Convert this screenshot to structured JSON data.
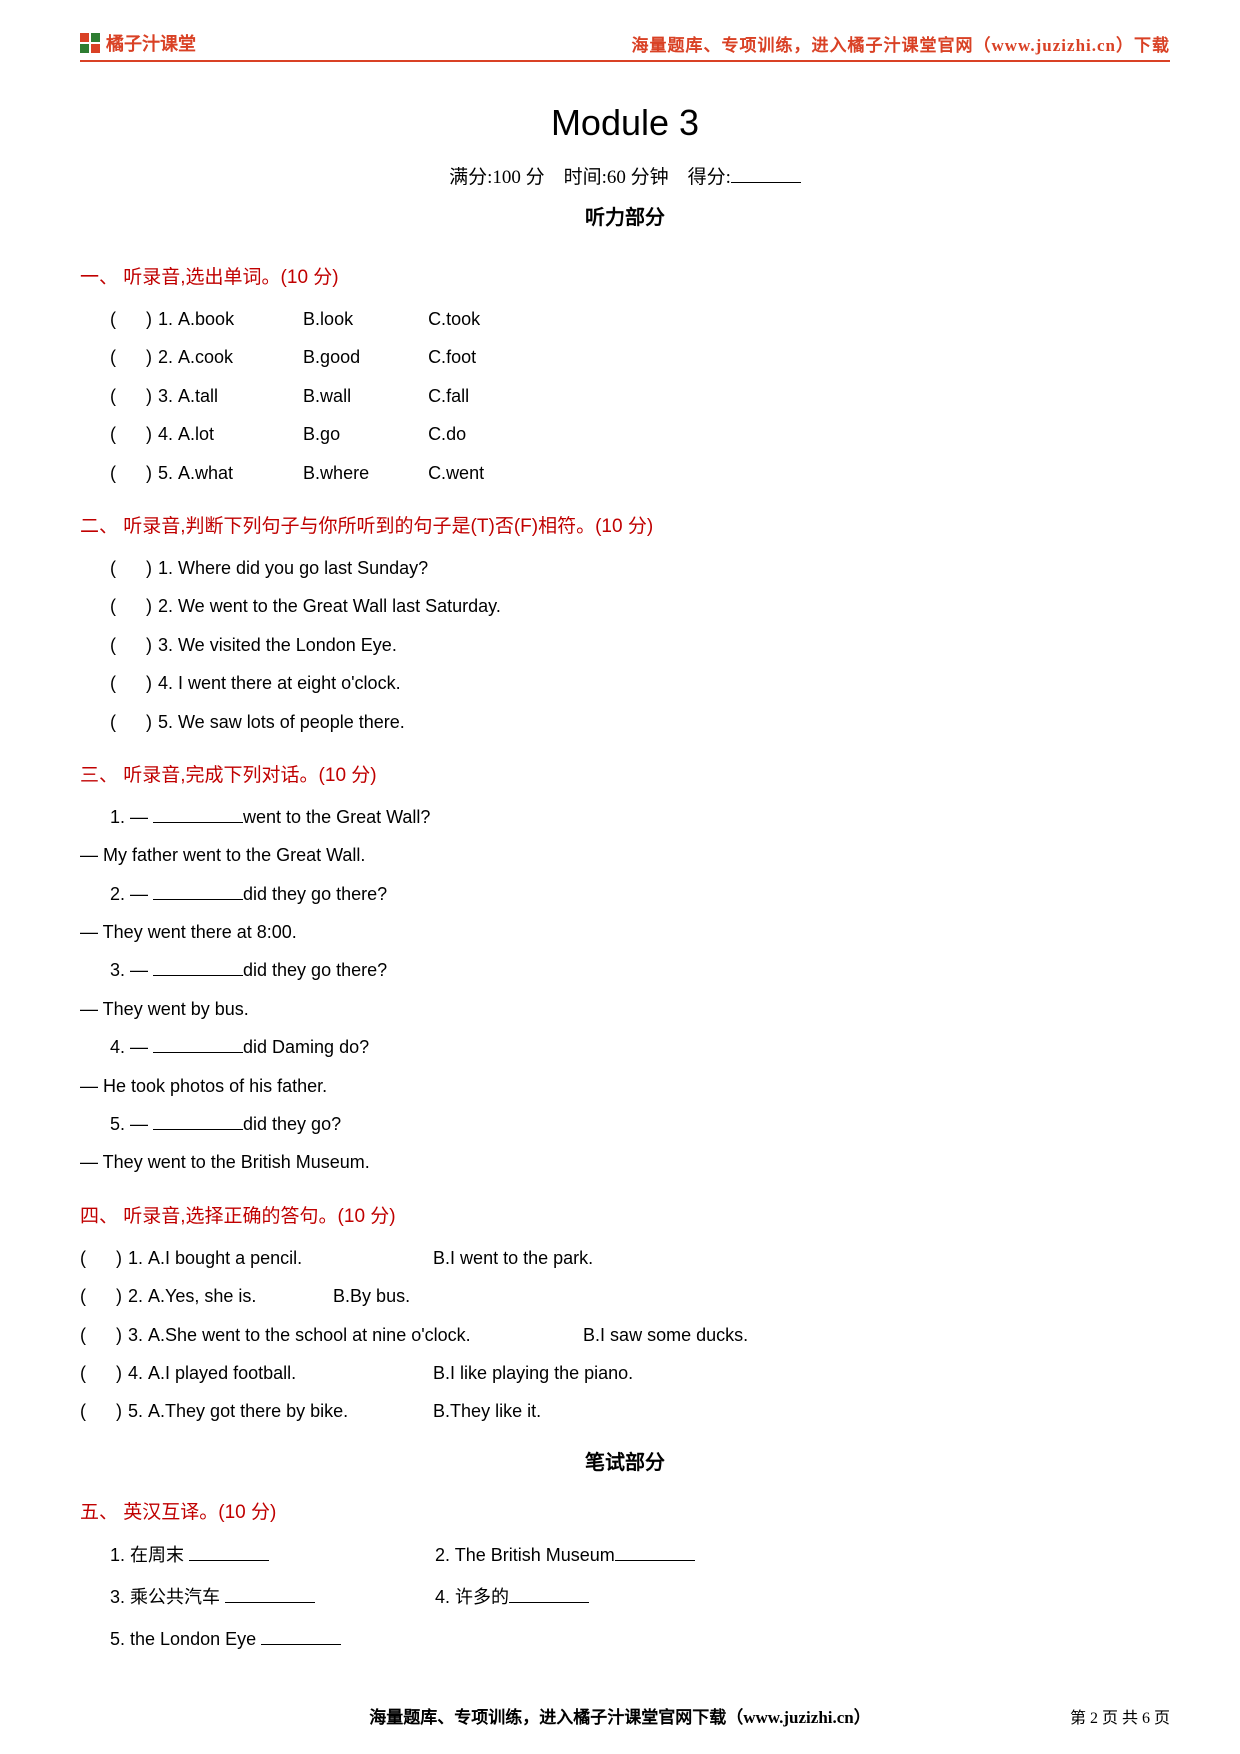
{
  "header": {
    "logo_text": "橘子汁课堂",
    "right": "海量题库、专项训练，进入橘子汁课堂官网（www.juzizhi.cn）下载"
  },
  "title": "Module 3",
  "meta": {
    "full_label": "满分:100 分",
    "time_label": "时间:60 分钟",
    "score_label": "得分:"
  },
  "listening_label": "听力部分",
  "writing_label": "笔试部分",
  "s1": {
    "title": "一、 听录音,选出单词。(10 分)",
    "rows": [
      {
        "n": "1.",
        "a": "A.book",
        "b": "B.look",
        "c": "C.took"
      },
      {
        "n": "2.",
        "a": "A.cook",
        "b": "B.good",
        "c": "C.foot"
      },
      {
        "n": "3.",
        "a": "A.tall",
        "b": "B.wall",
        "c": "C.fall"
      },
      {
        "n": "4.",
        "a": "A.lot",
        "b": "B.go",
        "c": "C.do"
      },
      {
        "n": "5.",
        "a": "A.what",
        "b": "B.where",
        "c": "C.went"
      }
    ]
  },
  "s2": {
    "title": "二、 听录音,判断下列句子与你所听到的句子是(T)否(F)相符。(10 分)",
    "rows": [
      "1. Where did you go last Sunday?",
      "2. We went to the Great Wall last Saturday.",
      "3. We visited the London Eye.",
      "4. I went there at eight o'clock.",
      "5. We saw lots of people there."
    ]
  },
  "s3": {
    "title": "三、 听录音,完成下列对话。(10 分)",
    "items": [
      {
        "q_pre": "1. —  ",
        "q_post": "went to the Great Wall?",
        "a": "— My father went to the Great Wall."
      },
      {
        "q_pre": "2. —  ",
        "q_post": "did they go there?",
        "a": "— They went there at 8:00."
      },
      {
        "q_pre": "3. —  ",
        "q_post": "did they go there?",
        "a": "— They went by bus."
      },
      {
        "q_pre": "4. —  ",
        "q_post": "did Daming do?",
        "a": "— He took photos of his father."
      },
      {
        "q_pre": "5. —  ",
        "q_post": "did they go?",
        "a": "— They went to the British Museum."
      }
    ]
  },
  "s4": {
    "title": "四、 听录音,选择正确的答句。(10 分)",
    "rows": [
      {
        "n": "1.",
        "a": "A.I bought a pencil.",
        "b": "B.I went to the park."
      },
      {
        "n": "2.",
        "a": "A.Yes, she is.",
        "b": "B.By bus."
      },
      {
        "n": "3.",
        "a": "A.She went to the school at nine o'clock.",
        "b": "B.I saw some ducks."
      },
      {
        "n": "4.",
        "a": "A.I played football.",
        "b": "B.I like playing the piano."
      },
      {
        "n": "5.",
        "a": "A.They got there by bike.",
        "b": "B.They like it."
      }
    ]
  },
  "s5": {
    "title": "五、 英汉互译。(10 分)",
    "i1": "1.  在周末",
    "i2": "2.  The British Museum",
    "i3": "3.  乘公共汽车",
    "i4": "4.  许多的",
    "i5": "5. the London Eye"
  },
  "footer": {
    "text": "海量题库、专项训练，进入橘子汁课堂官网下载（www.juzizhi.cn）",
    "page": "第 2 页 共 6 页"
  }
}
